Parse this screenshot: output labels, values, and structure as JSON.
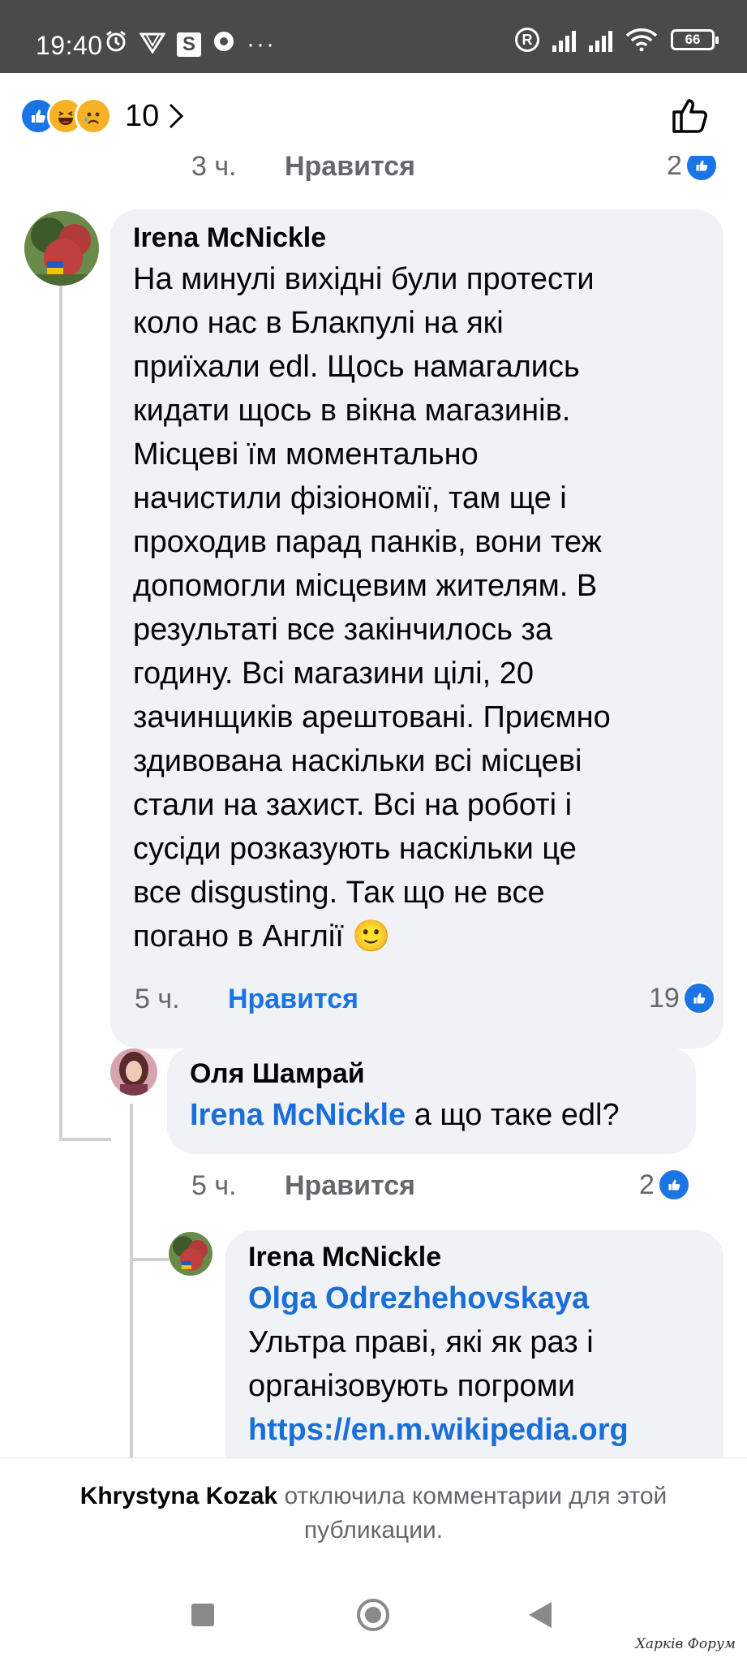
{
  "status_bar": {
    "time": "19:40",
    "battery": "66",
    "left_icons": [
      "alarm-icon",
      "vpn-icon",
      "s-app-icon",
      "chrome-icon",
      "more-icon"
    ],
    "right_icons": [
      "r-icon",
      "signal-icon",
      "signal-icon",
      "wifi-icon",
      "battery-icon"
    ]
  },
  "header": {
    "reactions": [
      "like",
      "haha",
      "sad"
    ],
    "reaction_count": "10"
  },
  "comments": {
    "prev": {
      "time": "3 ч.",
      "like": "Нравится",
      "count": "2"
    },
    "c1": {
      "author": "Irena McNickle",
      "lines": [
        "На минулі вихідні були протести",
        "коло нас в Блакпулі на які",
        "приїхали edl. Щось намагались",
        "кидати щось в вікна магазинів.",
        "Місцеві їм моментально",
        "начистили фізіономії, там ще і",
        "проходив парад панків, вони теж",
        "допомогли місцевим жителям. В",
        "результаті все закінчилось за",
        "годину. Всі магазини цілі, 20",
        "зачинщиків арештовані. Приємно",
        "здивована наскільки всі місцеві",
        "стали на захист. Всі на роботі і",
        "сусіди розказують наскільки це",
        "все disgusting. Так що не все",
        "погано в Англії 🙂"
      ],
      "time": "5 ч.",
      "like": "Нравится",
      "count": "19"
    },
    "c2": {
      "author": "Оля Шамрай",
      "mention": "Irena McNickle",
      "text": " а що таке edl?",
      "time": "5 ч.",
      "like": "Нравится",
      "count": "2"
    },
    "c3": {
      "author": "Irena McNickle",
      "mention": "Olga Odrezhehovskaya",
      "line1": "Ультра праві, які як раз і",
      "line2": "організовують погроми",
      "url": "https://en.m.wikipedia.org"
    }
  },
  "footer": {
    "name": "Khrystyna Kozak",
    "text": " отключила комментарии для этой публикации."
  },
  "watermark": "Харків Форум"
}
